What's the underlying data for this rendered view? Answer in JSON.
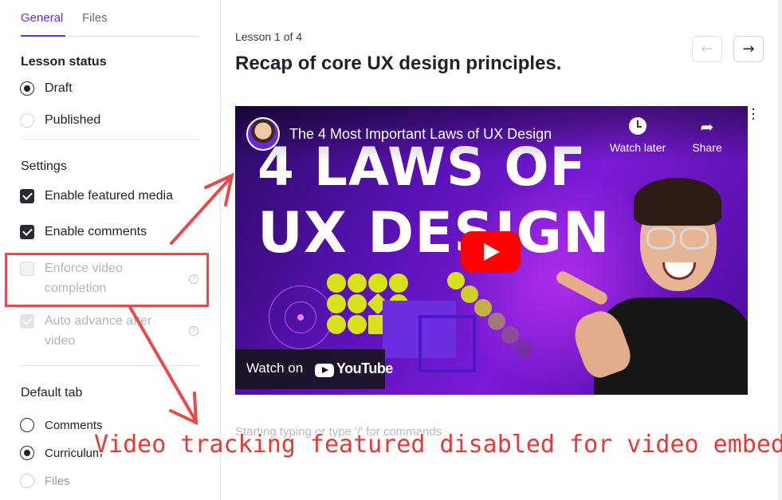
{
  "sidebar": {
    "tabs": [
      {
        "label": "General",
        "active": true
      },
      {
        "label": "Files",
        "active": false
      }
    ],
    "lesson_status": {
      "title": "Lesson status",
      "options": [
        {
          "label": "Draft",
          "selected": true
        },
        {
          "label": "Published",
          "selected": false
        }
      ]
    },
    "settings": {
      "title": "Settings",
      "items": [
        {
          "label": "Enable featured media",
          "checked": true,
          "disabled": false
        },
        {
          "label": "Enable comments",
          "checked": true,
          "disabled": false
        },
        {
          "label": "Enforce video completion",
          "checked": false,
          "disabled": true,
          "help": "?"
        },
        {
          "label": "Auto advance after video",
          "checked": true,
          "disabled": true,
          "help": "?"
        }
      ]
    },
    "default_tab": {
      "title": "Default tab",
      "options": [
        {
          "label": "Comments",
          "selected": false
        },
        {
          "label": "Curriculum",
          "selected": true
        },
        {
          "label": "Files",
          "selected": false
        }
      ]
    }
  },
  "main": {
    "lesson_count": "Lesson 1 of 4",
    "title": "Recap of core UX design principles.",
    "nav": {
      "prev_icon": "arrow-left-icon",
      "next_icon": "arrow-right-icon",
      "prev_disabled": true
    },
    "video": {
      "title": "The 4 Most Important Laws of UX Design",
      "thumbnail_line1": "4 LAWS OF",
      "thumbnail_line2": "UX DESIGN",
      "watch_later": "Watch later",
      "share": "Share",
      "watch_on": "Watch on",
      "youtube": "YouTube"
    },
    "editor_placeholder": "Starting typing or type '/' for commands"
  },
  "annotation": {
    "caption": "Video tracking featured disabled for video embeds",
    "color": "#e53935"
  },
  "colors": {
    "accent": "#6d28d9",
    "youtube_red": "#ff0000"
  }
}
